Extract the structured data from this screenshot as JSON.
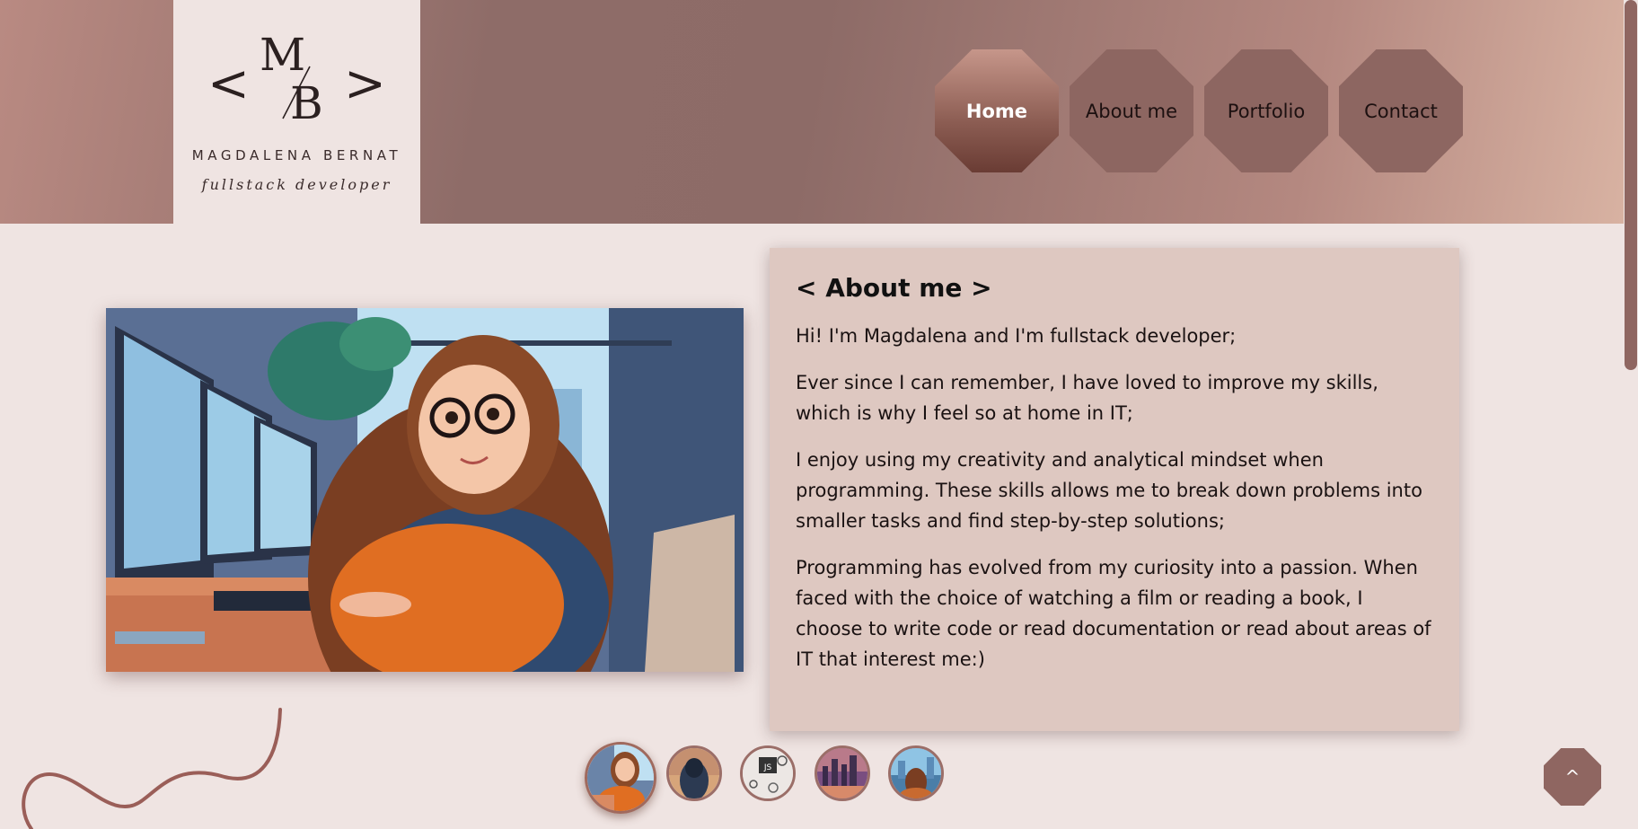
{
  "logo": {
    "monogram_left": "<",
    "monogram_m": "M",
    "monogram_b": "B",
    "monogram_right": ">",
    "name": "MAGDALENA BERNAT",
    "role": "fullstack developer"
  },
  "nav": {
    "items": [
      {
        "label": "Home",
        "active": true
      },
      {
        "label": "About me",
        "active": false
      },
      {
        "label": "Portfolio",
        "active": false
      },
      {
        "label": "Contact",
        "active": false
      }
    ]
  },
  "about": {
    "title": "< About me >",
    "paragraphs": [
      "Hi! I'm Magdalena and I'm fullstack developer;",
      "Ever since I can remember, I have loved to improve my skills, which is why I feel so at home in IT;",
      "I enjoy using my creativity and analytical mindset when programming. These skills allows me to break down problems into smaller tasks and find step-by-step solutions;",
      "Programming has evolved from my curiosity into a passion. When faced with the choice of watching a film or reading a book, I choose to write code or read documentation or read about areas of IT that interest me:)"
    ]
  },
  "gallery": {
    "thumbnails": [
      {
        "name": "girl-at-computer-thumbnail",
        "selected": true
      },
      {
        "name": "hooded-figure-thumbnail",
        "selected": false
      },
      {
        "name": "js-tech-icons-thumbnail",
        "selected": false
      },
      {
        "name": "city-skyline-thumbnail",
        "selected": false
      },
      {
        "name": "girl-city-window-thumbnail",
        "selected": false
      }
    ],
    "thumb_js_text": "JS"
  },
  "scroll_top": {
    "label": "^"
  },
  "colors": {
    "accent": "#8f6661",
    "background": "#efe4e2",
    "card": "#dec8c1",
    "header_mid": "#8d6b67"
  }
}
